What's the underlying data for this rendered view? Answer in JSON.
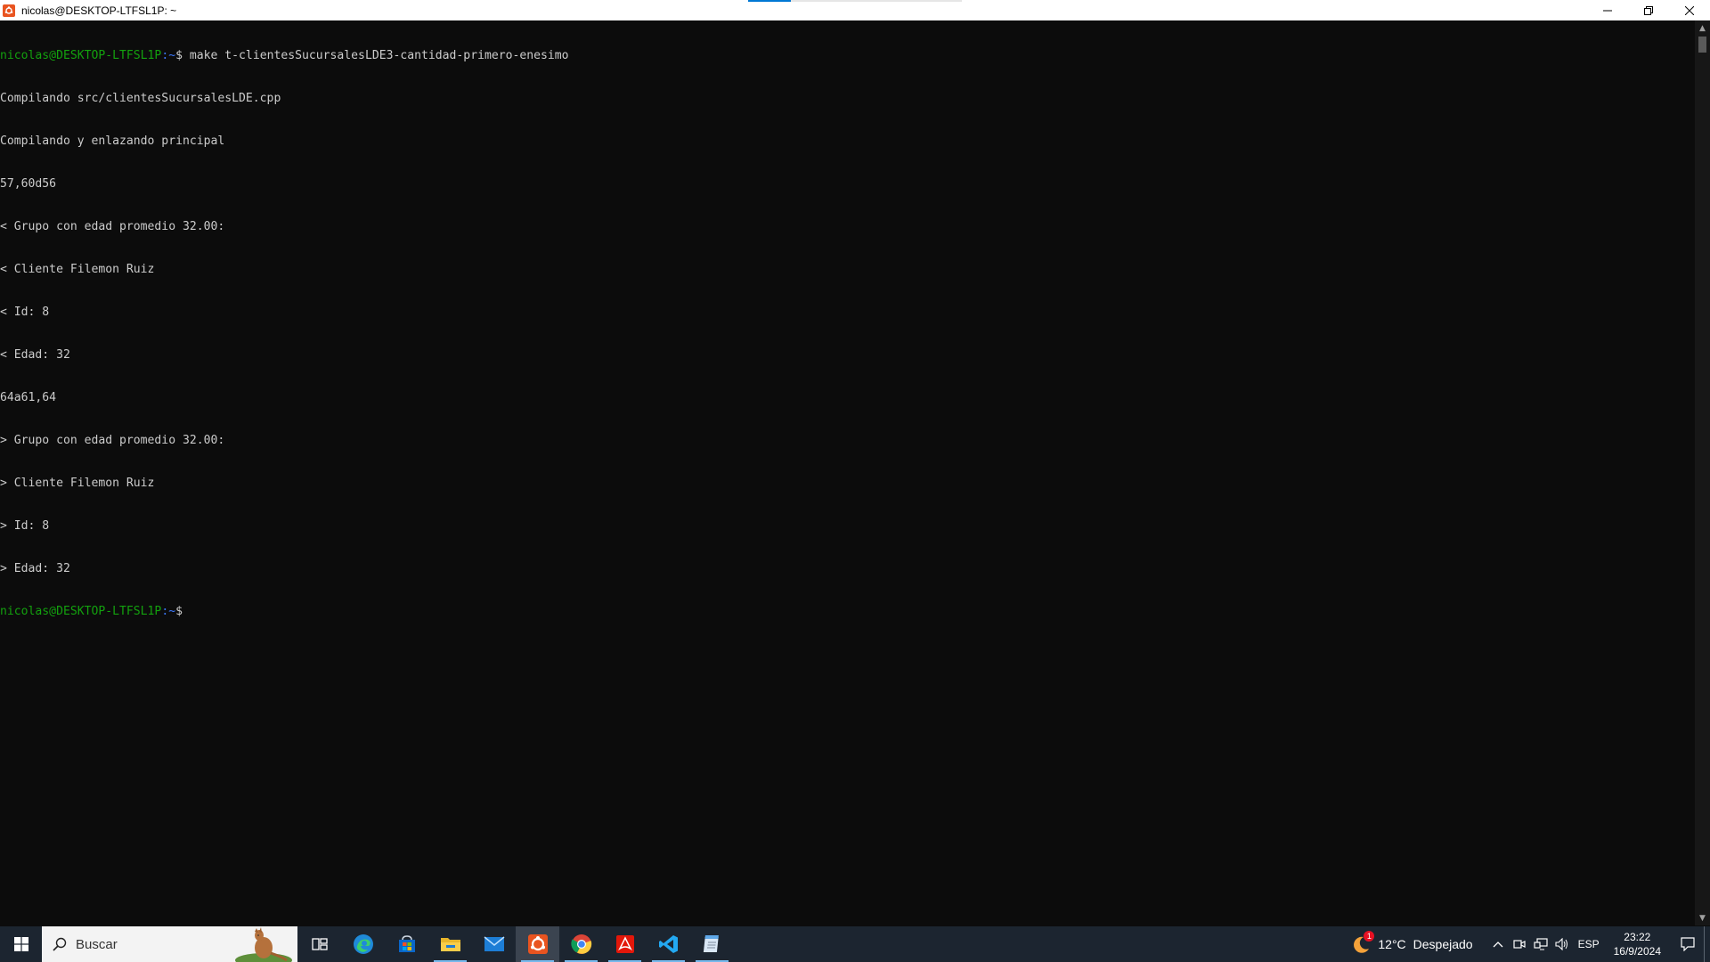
{
  "window": {
    "title": "nicolas@DESKTOP-LTFSL1P: ~",
    "app_icon": "ubuntu-icon",
    "controls": [
      "minimize-icon",
      "restore-icon",
      "close-icon"
    ]
  },
  "terminal": {
    "prompt": {
      "user_host": "nicolas@DESKTOP-LTFSL1P",
      "path": ":~",
      "symbol": "$"
    },
    "command": " make t-clientesSucursalesLDE3-cantidad-primero-enesimo",
    "output": [
      "Compilando src/clientesSucursalesLDE.cpp",
      "Compilando y enlazando principal",
      "57,60d56",
      "< Grupo con edad promedio 32.00:",
      "< Cliente Filemon Ruiz",
      "< Id: 8",
      "< Edad: 32",
      "64a61,64",
      "> Grupo con edad promedio 32.00:",
      "> Cliente Filemon Ruiz",
      "> Id: 8",
      "> Edad: 32"
    ],
    "colors": {
      "background": "#0c0c0c",
      "text": "#cccccc",
      "user_host": "#13a10e",
      "path": "#3b78ff"
    }
  },
  "taskbar": {
    "search_placeholder": "Buscar",
    "pinned": [
      {
        "name": "task-view-icon"
      },
      {
        "name": "edge-icon"
      },
      {
        "name": "microsoft-store-icon"
      },
      {
        "name": "file-explorer-icon"
      },
      {
        "name": "mail-icon"
      },
      {
        "name": "ubuntu-icon"
      },
      {
        "name": "chrome-icon"
      },
      {
        "name": "acrobat-icon"
      },
      {
        "name": "vscode-icon"
      },
      {
        "name": "notepad-icon"
      }
    ],
    "weather": {
      "badge": "1",
      "temperature": "12°C",
      "condition": "Despejado"
    },
    "language": "ESP",
    "time": "23:22",
    "date": "16/9/2024"
  }
}
